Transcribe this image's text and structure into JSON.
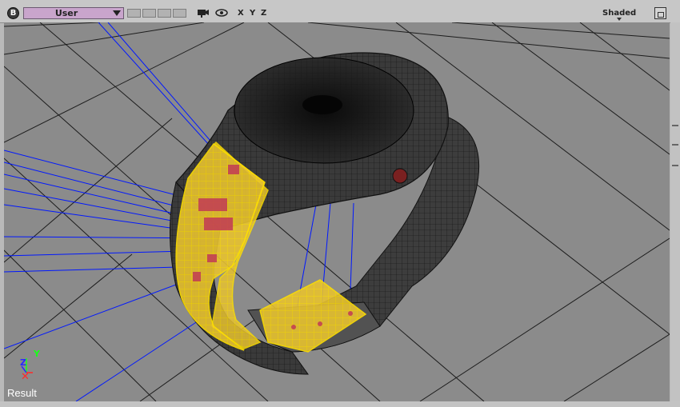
{
  "toolbar": {
    "b_button": "B",
    "camera_mode": "User",
    "axes": [
      "X",
      "Y",
      "Z"
    ],
    "shading_mode": "Shaded",
    "icons": [
      "b-button-icon",
      "camera-icon",
      "eye-icon",
      "maximize-icon"
    ]
  },
  "viewport": {
    "status_label": "Result",
    "gizmo": {
      "z_label": "Z",
      "y_label": "Y"
    },
    "background_color": "#8b8b8b",
    "grid_color": "#000000",
    "selection_color": "#ffd83a",
    "guide_line_color": "#0018ff"
  }
}
